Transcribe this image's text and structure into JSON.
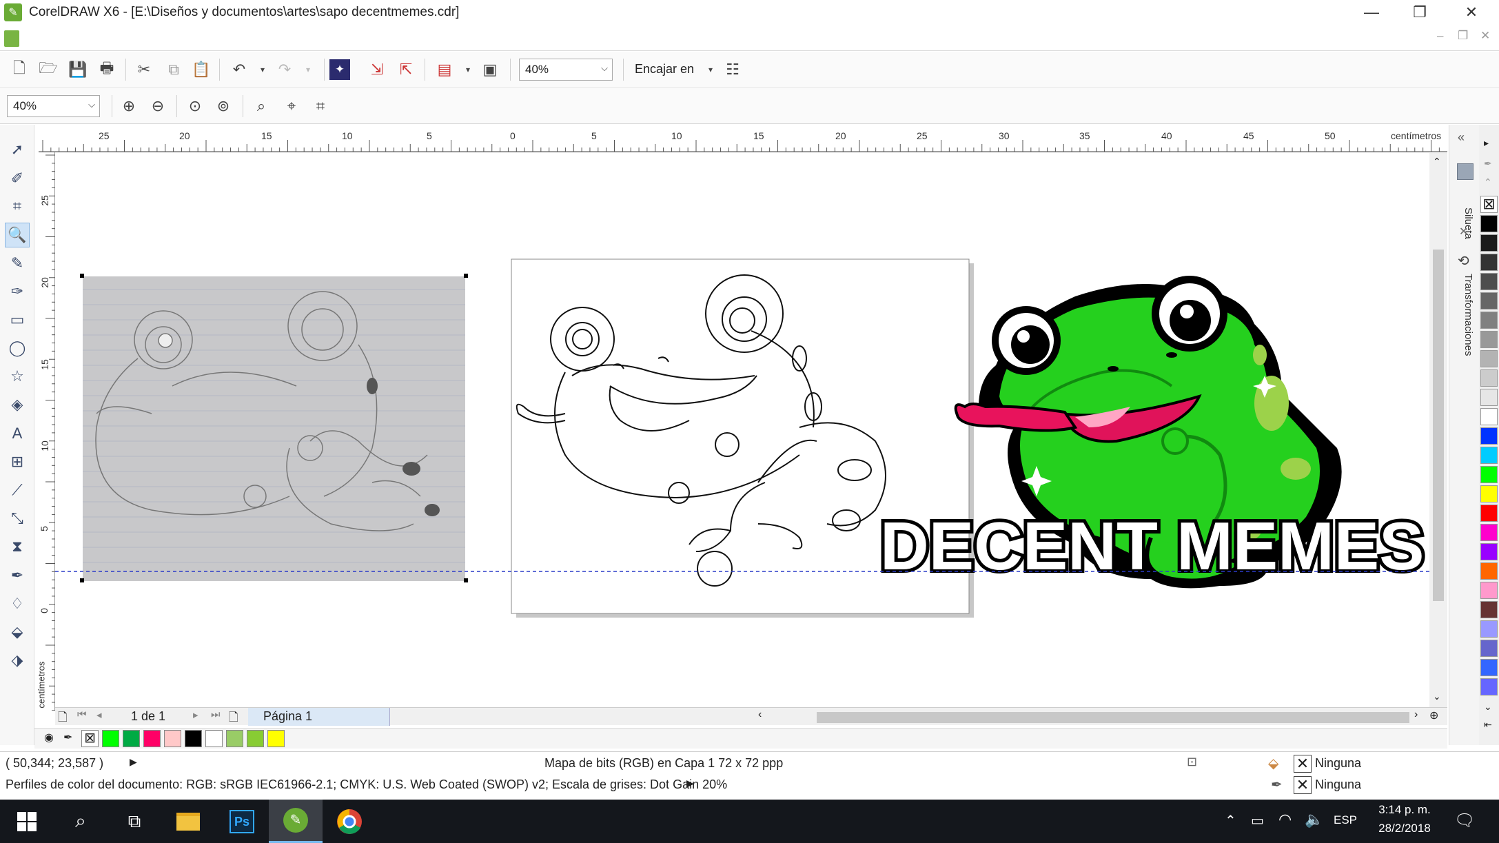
{
  "window": {
    "app_title": "CorelDRAW X6 - [E:\\Diseños y documentos\\artes\\sapo decentmemes.cdr]",
    "minimize_icon": "minimize-icon",
    "restore_icon": "restore-icon",
    "close_icon": "close-icon"
  },
  "toolbar": {
    "zoom_level": "40%",
    "snap_label": "Encajar en"
  },
  "zoom_toolbar": {
    "zoom_level": "40%"
  },
  "rulers": {
    "horizontal_labels": [
      "25",
      "20",
      "15",
      "10",
      "5",
      "0",
      "5",
      "10",
      "15",
      "20",
      "25",
      "30",
      "35",
      "40",
      "45",
      "50"
    ],
    "horizontal_unit": "centímetros",
    "vertical_labels": [
      "25",
      "20",
      "15",
      "10",
      "5",
      "0"
    ],
    "vertical_unit": "centímetros"
  },
  "canvas": {
    "logo_text": "DECENT MEMES"
  },
  "docker": {
    "tabs": [
      "Silueta",
      "Transformaciones"
    ]
  },
  "page_nav": {
    "page_count": "1 de 1",
    "page_tab": "Página 1"
  },
  "status": {
    "coordinates": "( 50,344; 23,587 )",
    "object_info": "Mapa de bits (RGB) en Capa 1 72 x 72 ppp",
    "fill_value": "Ninguna",
    "outline_value": "Ninguna",
    "color_profile": "Perfiles de color del documento: RGB: sRGB IEC61966-2.1; CMYK: U.S. Web Coated (SWOP) v2; Escala de grises: Dot Gain 20%"
  },
  "document_palette": [
    "#00ff00",
    "#00aa44",
    "#ff0066",
    "#ffc8c8",
    "#000000",
    "#ffffff",
    "#99cc66",
    "#88cc33",
    "#ffff00"
  ],
  "color_palette": [
    "#000000",
    "#1a1a1a",
    "#333333",
    "#4d4d4d",
    "#666666",
    "#808080",
    "#999999",
    "#b3b3b3",
    "#cccccc",
    "#e6e6e6",
    "#ffffff",
    "#0033ff",
    "#00ccff",
    "#00ff00",
    "#ffff00",
    "#ff0000",
    "#ff00cc",
    "#9900ff",
    "#ff6600",
    "#ff99cc",
    "#663333",
    "#9999ff",
    "#6666cc",
    "#3366ff",
    "#6666ff"
  ],
  "taskbar": {
    "language": "ESP",
    "time": "3:14 p. m.",
    "date": "28/2/2018",
    "ps_label": "Ps"
  }
}
